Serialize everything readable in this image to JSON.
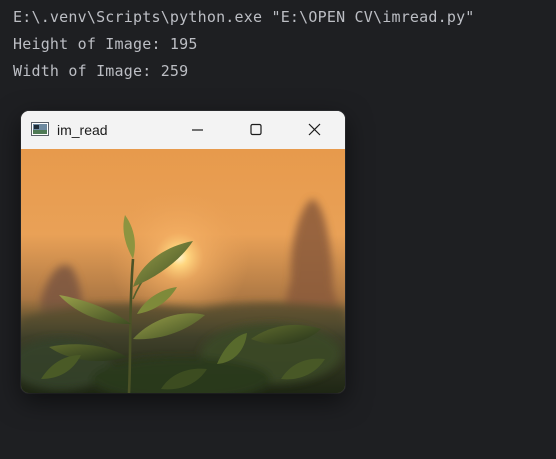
{
  "terminal": {
    "lines": [
      "E:\\.venv\\Scripts\\python.exe \"E:\\OPEN CV\\imread.py\"",
      "Height of Image: 195",
      "Width of Image: 259"
    ]
  },
  "window": {
    "title": "im_read",
    "icons": {
      "app": "opencv-window-icon",
      "minimize": "minimize-icon",
      "maximize": "maximize-icon",
      "close": "close-icon"
    }
  },
  "colors": {
    "terminal_bg": "#1e1f22",
    "terminal_text": "#bcbec4",
    "titlebar_bg": "#f3f3f3"
  }
}
